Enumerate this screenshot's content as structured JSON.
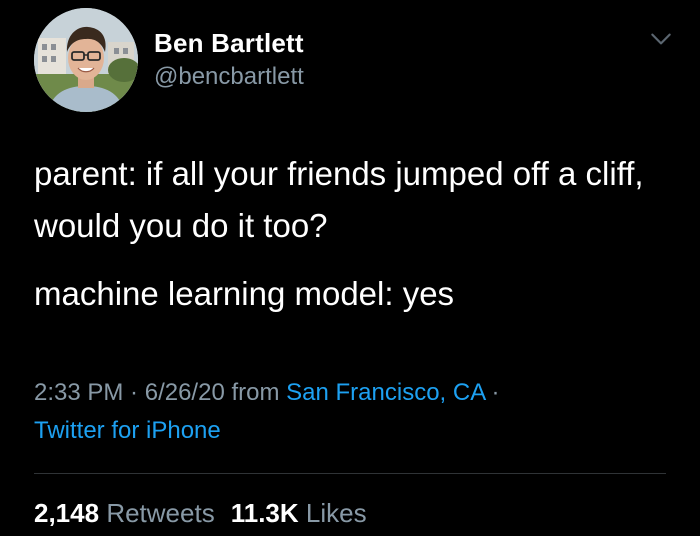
{
  "user": {
    "display_name": "Ben Bartlett",
    "handle": "@bencbartlett"
  },
  "tweet": {
    "line1": "parent: if all your friends jumped off a cliff, would you do it too?",
    "line2": "machine learning model: yes"
  },
  "meta": {
    "time": "2:33 PM",
    "sep1": " · ",
    "date": "6/26/20",
    "from": " from ",
    "location": "San Francisco, CA",
    "sep2": " · ",
    "source": "Twitter for iPhone"
  },
  "stats": {
    "retweets_count": "2,148",
    "retweets_label": "Retweets",
    "likes_count": "11.3K",
    "likes_label": "Likes"
  },
  "colors": {
    "background": "#000000",
    "primary_text": "#ffffff",
    "secondary_text": "#8899a6",
    "link": "#1da1f2",
    "divider": "#2f3336"
  },
  "icons": {
    "options": "chevron-down-icon"
  }
}
